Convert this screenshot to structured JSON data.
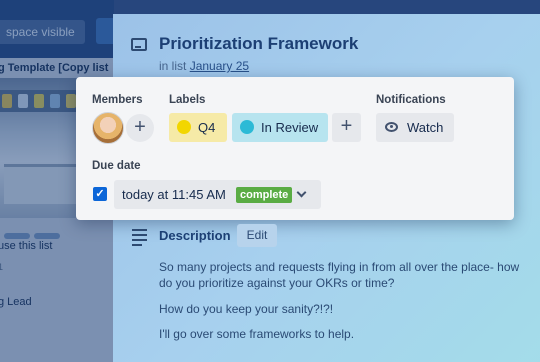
{
  "board": {
    "workspace_button": "space visible",
    "list_title": "g Template [Copy list",
    "use_list": "use this list",
    "count": "1",
    "team_lead": "g Lead"
  },
  "card": {
    "title": "Prioritization Framework",
    "in_list_prefix": "in list",
    "list_name": "January 25"
  },
  "panel": {
    "members_label": "Members",
    "labels_label": "Labels",
    "notifications_label": "Notifications",
    "add_symbol": "+",
    "labels": [
      {
        "text": "Q4",
        "color": "#f2d600",
        "bg": "#f6eaa7"
      },
      {
        "text": "In Review",
        "color": "#2cbad6",
        "bg": "#b7e4ef"
      }
    ],
    "watch_label": "Watch",
    "due_label": "Due date",
    "due_checked": true,
    "due_value": "today at 11:45 AM",
    "complete_badge": "complete"
  },
  "description": {
    "title": "Description",
    "edit_label": "Edit",
    "paragraphs": [
      "So many projects and requests flying in from all over the place- how do you prioritize against your OKRs or time?",
      "How do you keep your sanity?!?!",
      "I'll go over some frameworks to help."
    ]
  },
  "colors": {
    "complete_green": "#5aac44",
    "checkbox_blue": "#0c66d8",
    "title_blue": "#1c3f74"
  }
}
